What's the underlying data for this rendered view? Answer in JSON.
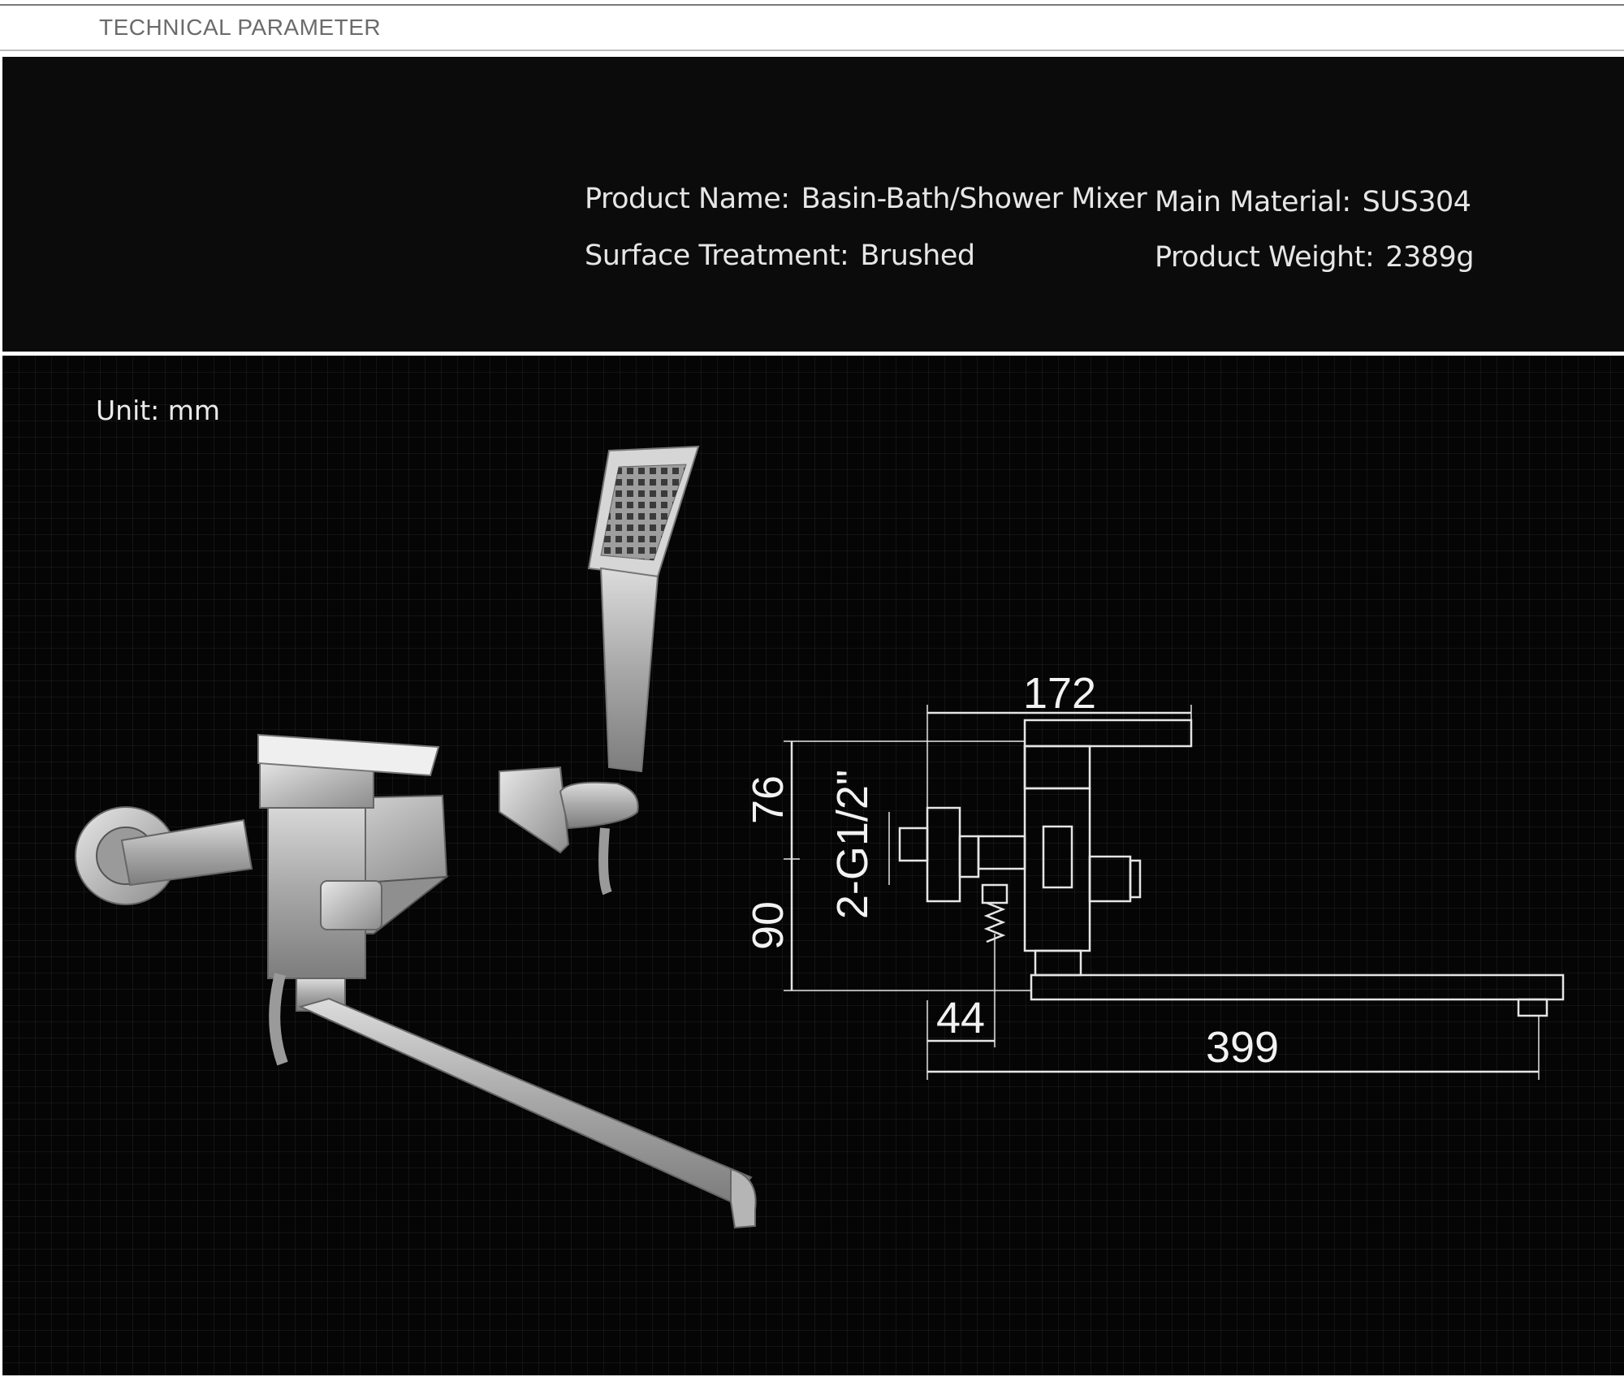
{
  "header": {
    "title": "TECHNICAL PARAMETER"
  },
  "specs": {
    "product_name": {
      "label": "Product Name:",
      "value": "Basin-Bath/Shower Mixer"
    },
    "main_material": {
      "label": "Main Material:",
      "value": "SUS304"
    },
    "surface_treatment": {
      "label": "Surface Treatment:",
      "value": "Brushed"
    },
    "product_weight": {
      "label": "Product Weight:",
      "value": "2389g"
    }
  },
  "drawing": {
    "unit": "Unit: mm",
    "dimensions": {
      "width_top": "172",
      "height_upper": "76",
      "height_lower": "90",
      "thread": "2-G1/2\"",
      "offset": "44",
      "spout_length": "399"
    }
  },
  "colors": {
    "background_dark": "#0b0b0b",
    "text_light": "#e6e6e6",
    "header_text": "#6b6b6b",
    "metal": "#c9c9c9"
  }
}
